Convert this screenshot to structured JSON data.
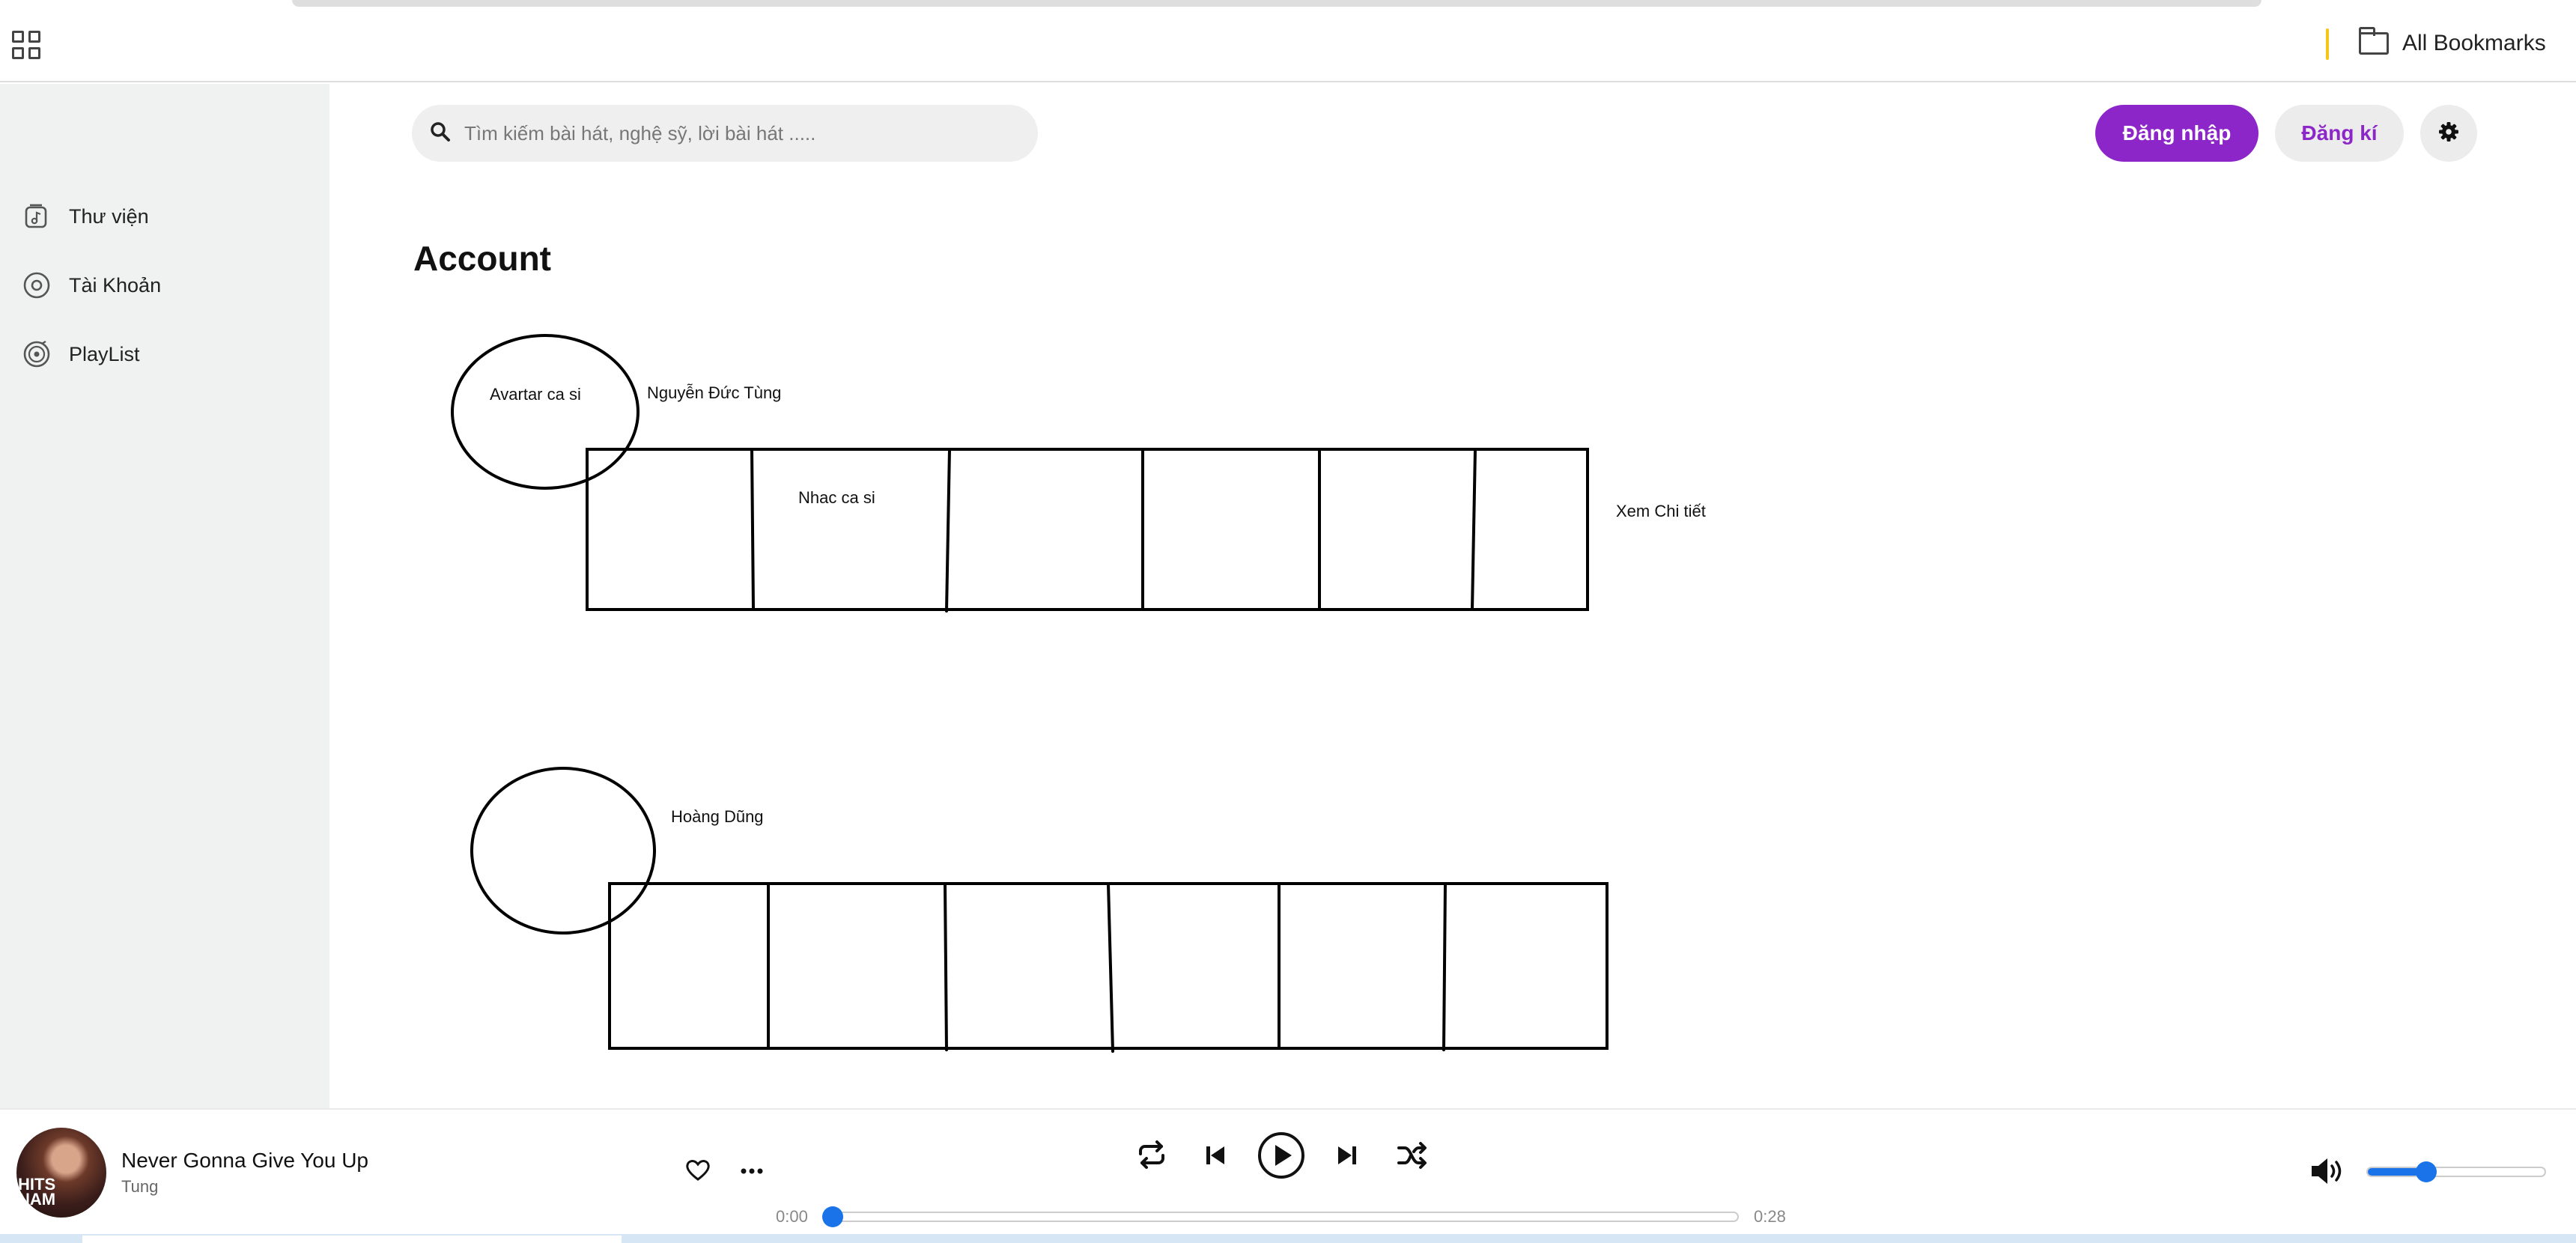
{
  "browser": {
    "bookmarks_label": "All Bookmarks"
  },
  "sidebar": {
    "items": [
      {
        "label": "Thư viện",
        "icon": "library-icon"
      },
      {
        "label": "Tài Khoản",
        "icon": "account-circle-icon"
      },
      {
        "label": "PlayList",
        "icon": "playlist-icon"
      }
    ]
  },
  "header": {
    "search_placeholder": "Tìm kiếm bài hát, nghệ sỹ, lời bài hát .....",
    "login_label": "Đăng nhập",
    "signup_label": "Đăng kí",
    "settings_icon": "gear-icon"
  },
  "main": {
    "title": "Account",
    "sketch": {
      "avatar_label": "Avartar ca si",
      "artist1_name": "Nguyễn Đức Tùng",
      "songs_label": "Nhac ca si",
      "details_link": "Xem Chi tiết",
      "artist2_name": "Hoàng Dũng"
    }
  },
  "player": {
    "track_title": "Never Gonna Give You Up",
    "artist": "Tung",
    "cover_text": "HITS\nNAM",
    "time_current": "0:00",
    "time_total": "0:28",
    "progress": 0,
    "volume": 0.33,
    "accent": "#1a73e8",
    "brand": "#8c26c8"
  }
}
